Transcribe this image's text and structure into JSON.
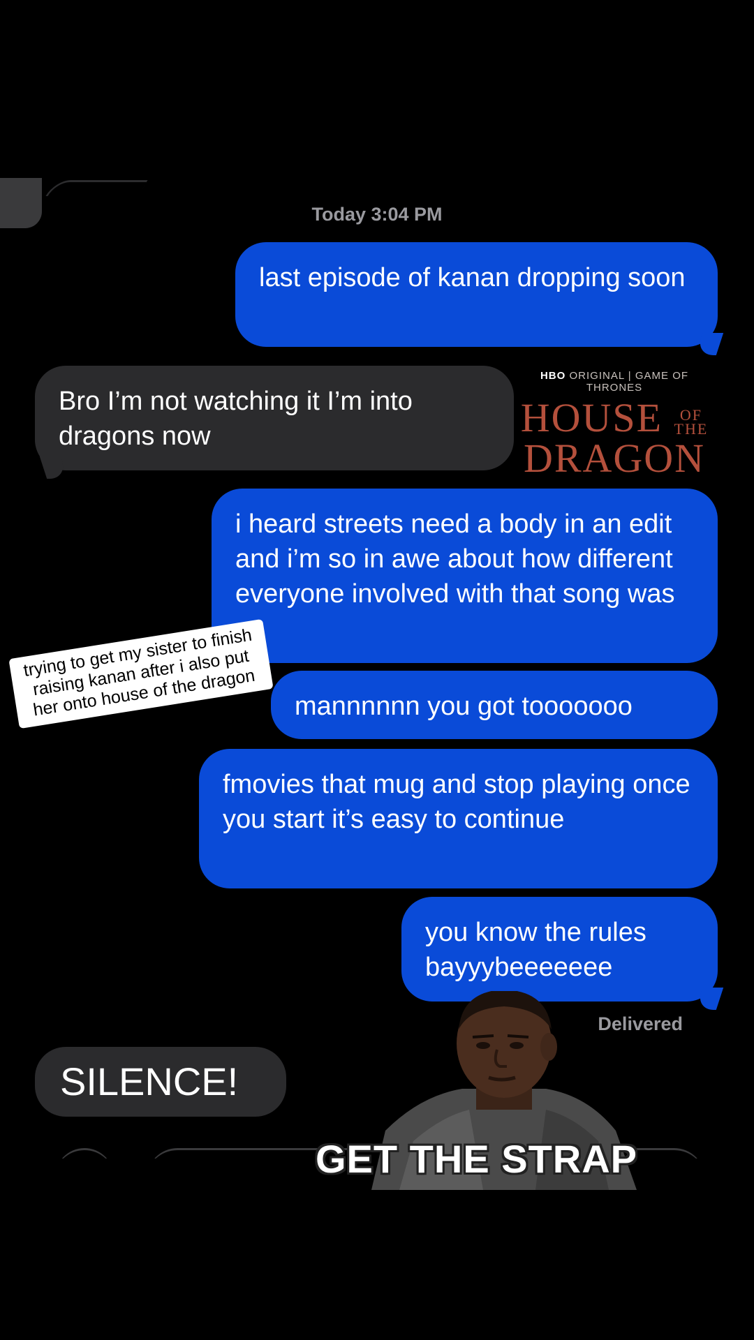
{
  "timestamp": "Today 3:04 PM",
  "messages": [
    {
      "id": "b1",
      "direction": "outgoing",
      "text": "last episode of kanan dropping soon"
    },
    {
      "id": "b2",
      "direction": "incoming",
      "text": "Bro I’m not watching it I’m into dragons now"
    },
    {
      "id": "b3",
      "direction": "outgoing",
      "text": "i heard streets need a body in an edit and i’m so in awe about how different everyone involved with that song was"
    },
    {
      "id": "b4",
      "direction": "outgoing",
      "text": "mannnnnn you got tooooooo"
    },
    {
      "id": "b5",
      "direction": "outgoing",
      "text": "fmovies that mug and stop playing once you start it’s easy to continue"
    },
    {
      "id": "b6",
      "direction": "outgoing",
      "text": "you know the rules bayyybeeeeeee"
    },
    {
      "id": "b7",
      "direction": "incoming",
      "text": "SILENCE!"
    }
  ],
  "delivered_label": "Delivered",
  "logo": {
    "network": "HBO",
    "original": "ORIGINAL",
    "franchise": "GAME OF THRONES",
    "title_line1": "HOUSE",
    "title_of": "OF",
    "title_the": "THE",
    "title_line2": "DRAGON"
  },
  "sticker_text": "trying to get my sister to finish raising kanan after i also put her onto house of the dragon",
  "meme_caption": "GET THE STRAP",
  "colors": {
    "outgoing_bubble": "#0a4bd8",
    "incoming_bubble": "#2b2b2d",
    "background": "#000000",
    "meta_text": "#9a9a9f",
    "logo_red": "#b4503c"
  }
}
